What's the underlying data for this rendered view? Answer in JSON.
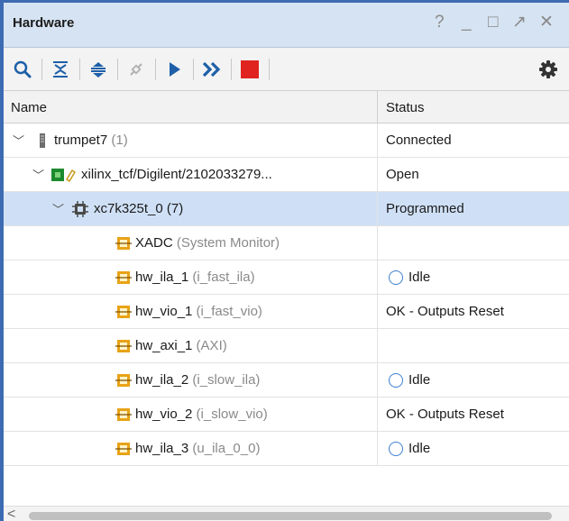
{
  "panel": {
    "title": "Hardware",
    "window_controls": [
      "?",
      "_",
      "□",
      "↗",
      "✕"
    ]
  },
  "toolbar": {
    "icons": [
      "search-icon",
      "collapse-all-icon",
      "expand-all-icon",
      "auto-connect-icon",
      "run-trigger-icon",
      "run-trigger-immediate-icon",
      "stop-trigger-icon",
      "settings-gear-icon"
    ],
    "colors": {
      "accent": "#1e5fa8",
      "stop": "#e0231e",
      "disabled": "#b0b0b0"
    }
  },
  "table": {
    "headers": {
      "name": "Name",
      "status": "Status"
    },
    "rows": [
      {
        "name": "trumpet7",
        "sub": " (1)",
        "status": "Connected",
        "icon": "server-icon",
        "idle": false
      },
      {
        "name": "xilinx_tcf/Digilent/2102033279...",
        "sub": "",
        "status": "Open",
        "icon": "board-icon",
        "idle": false
      },
      {
        "name": "xc7k325t_0",
        "sub": " (7)",
        "status": "Programmed",
        "icon": "chip-icon",
        "idle": false
      },
      {
        "name": "XADC",
        "sub": " (System Monitor)",
        "status": "",
        "icon": "debug-core-icon",
        "idle": false
      },
      {
        "name": "hw_ila_1",
        "sub": " (i_fast_ila)",
        "status": "Idle",
        "icon": "debug-core-icon",
        "idle": true
      },
      {
        "name": "hw_vio_1",
        "sub": " (i_fast_vio)",
        "status": "OK - Outputs Reset",
        "icon": "debug-core-icon",
        "idle": false
      },
      {
        "name": "hw_axi_1",
        "sub": " (AXI)",
        "status": "",
        "icon": "debug-core-icon",
        "idle": false
      },
      {
        "name": "hw_ila_2",
        "sub": " (i_slow_ila)",
        "status": "Idle",
        "icon": "debug-core-icon",
        "idle": true
      },
      {
        "name": "hw_vio_2",
        "sub": " (i_slow_vio)",
        "status": "OK - Outputs Reset",
        "icon": "debug-core-icon",
        "idle": false
      },
      {
        "name": "hw_ila_3",
        "sub": " (u_ila_0_0)",
        "status": "Idle",
        "icon": "debug-core-icon",
        "idle": true
      }
    ]
  },
  "scrollbar": {
    "arrow": "<"
  }
}
